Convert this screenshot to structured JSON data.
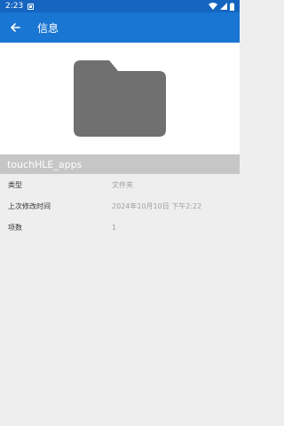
{
  "status_bar": {
    "time": "2:23",
    "notification_icon": "notification-icon",
    "icons": [
      "wifi-icon",
      "signal-icon",
      "battery-icon"
    ]
  },
  "app_bar": {
    "title": "信息",
    "back_icon": "arrow-back-icon",
    "color": "#1976d2"
  },
  "hero": {
    "icon": "folder-icon",
    "icon_color": "#707070"
  },
  "item": {
    "name": "touchHLE_apps"
  },
  "details": [
    {
      "label": "类型",
      "value": "文件夹"
    },
    {
      "label": "上次修改时间",
      "value": "2024年10月10日 下午2:22"
    },
    {
      "label": "项数",
      "value": "1"
    }
  ]
}
